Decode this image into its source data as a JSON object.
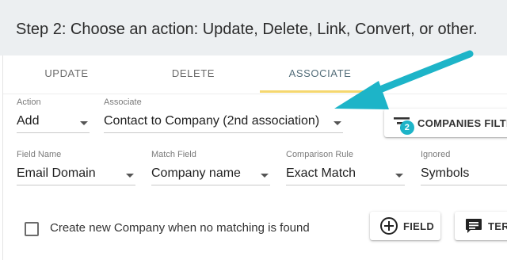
{
  "header": {
    "title": "Step 2: Choose an action: Update, Delete, Link, Convert, or other."
  },
  "tabs": [
    {
      "label": "UPDATE"
    },
    {
      "label": "DELETE"
    },
    {
      "label": "ASSOCIATE",
      "active": true
    }
  ],
  "row1": {
    "action": {
      "label": "Action",
      "value": "Add"
    },
    "associate": {
      "label": "Associate",
      "value": "Contact to Company (2nd association)"
    },
    "filters_button": {
      "label": "COMPANIES FILTE",
      "badge": "2",
      "icon": "filter-icon"
    }
  },
  "row2": {
    "field_name": {
      "label": "Field Name",
      "value": "Email Domain"
    },
    "match_field": {
      "label": "Match Field",
      "value": "Company name"
    },
    "comparison_rule": {
      "label": "Comparison Rule",
      "value": "Exact Match"
    },
    "ignored": {
      "label": "Ignored",
      "value": "Symbols"
    }
  },
  "row3": {
    "create_checkbox_label": "Create new Company when no matching is found",
    "create_checkbox_checked": false,
    "field_button": {
      "label": "FIELD",
      "icon": "plus-circle-icon"
    },
    "term_button": {
      "label": "TER",
      "icon": "comment-icon"
    }
  },
  "colors": {
    "accent_arrow": "#1db4c8",
    "tab_underline": "#f5d76e",
    "badge": "#1db4c8",
    "header_bg": "#eceff1"
  }
}
